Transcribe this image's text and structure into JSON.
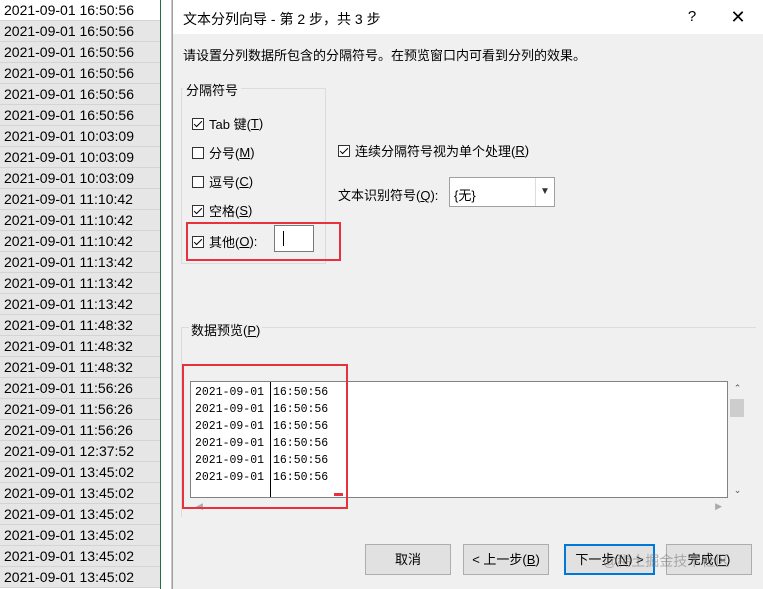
{
  "sheet": {
    "cells": [
      "2021-09-01 16:50:56",
      "2021-09-01 16:50:56",
      "2021-09-01 16:50:56",
      "2021-09-01 16:50:56",
      "2021-09-01 16:50:56",
      "2021-09-01 16:50:56",
      "2021-09-01 10:03:09",
      "2021-09-01 10:03:09",
      "2021-09-01 10:03:09",
      "2021-09-01 11:10:42",
      "2021-09-01 11:10:42",
      "2021-09-01 11:10:42",
      "2021-09-01 11:13:42",
      "2021-09-01 11:13:42",
      "2021-09-01 11:13:42",
      "2021-09-01 11:48:32",
      "2021-09-01 11:48:32",
      "2021-09-01 11:48:32",
      "2021-09-01 11:56:26",
      "2021-09-01 11:56:26",
      "2021-09-01 11:56:26",
      "2021-09-01 12:37:52",
      "2021-09-01 13:45:02",
      "2021-09-01 13:45:02",
      "2021-09-01 13:45:02",
      "2021-09-01 13:45:02",
      "2021-09-01 13:45:02",
      "2021-09-01 13:45:02"
    ]
  },
  "dialog": {
    "title": "文本分列向导 - 第 2 步，共 3 步",
    "help_label": "?",
    "close_label": "✕",
    "instruction": "请设置分列数据所包含的分隔符号。在预览窗口内可看到分列的效果。",
    "delimiters": {
      "legend": "分隔符号",
      "tab": {
        "text": "Tab 键(",
        "key": "T",
        "close": ")",
        "checked": true
      },
      "semicolon": {
        "text": "分号(",
        "key": "M",
        "close": ")",
        "checked": false
      },
      "comma": {
        "text": "逗号(",
        "key": "C",
        "close": ")",
        "checked": false
      },
      "space": {
        "text": "空格(",
        "key": "S",
        "close": ")",
        "checked": true
      },
      "other": {
        "text": "其他(",
        "key": "O",
        "close": "):",
        "checked": true,
        "value": ""
      }
    },
    "consecutive": {
      "text": "连续分隔符号视为单个处理(",
      "key": "R",
      "close": ")",
      "checked": true
    },
    "qualifier": {
      "text": "文本识别符号(",
      "key": "Q",
      "close": "):",
      "value": "{无}"
    },
    "preview": {
      "legend_text": "数据预览(",
      "legend_key": "P",
      "legend_close": ")",
      "rows": [
        [
          "2021-09-01",
          "16:50:56"
        ],
        [
          "2021-09-01",
          "16:50:56"
        ],
        [
          "2021-09-01",
          "16:50:56"
        ],
        [
          "2021-09-01",
          "16:50:56"
        ],
        [
          "2021-09-01",
          "16:50:56"
        ],
        [
          "2021-09-01",
          "16:50:56"
        ]
      ]
    },
    "buttons": {
      "cancel": "取消",
      "back_text": "< 上一步(",
      "back_key": "B",
      "back_close": ")",
      "next_text": "下一步(",
      "next_key": "N",
      "next_close": ") >",
      "finish_text": "完成(",
      "finish_key": "F",
      "finish_close": ")"
    },
    "watermark": "@稀土掘金技术社区"
  },
  "colors": {
    "accent": "#0078d7",
    "highlight": "#e5323b",
    "sheet_border": "#1e7145"
  }
}
